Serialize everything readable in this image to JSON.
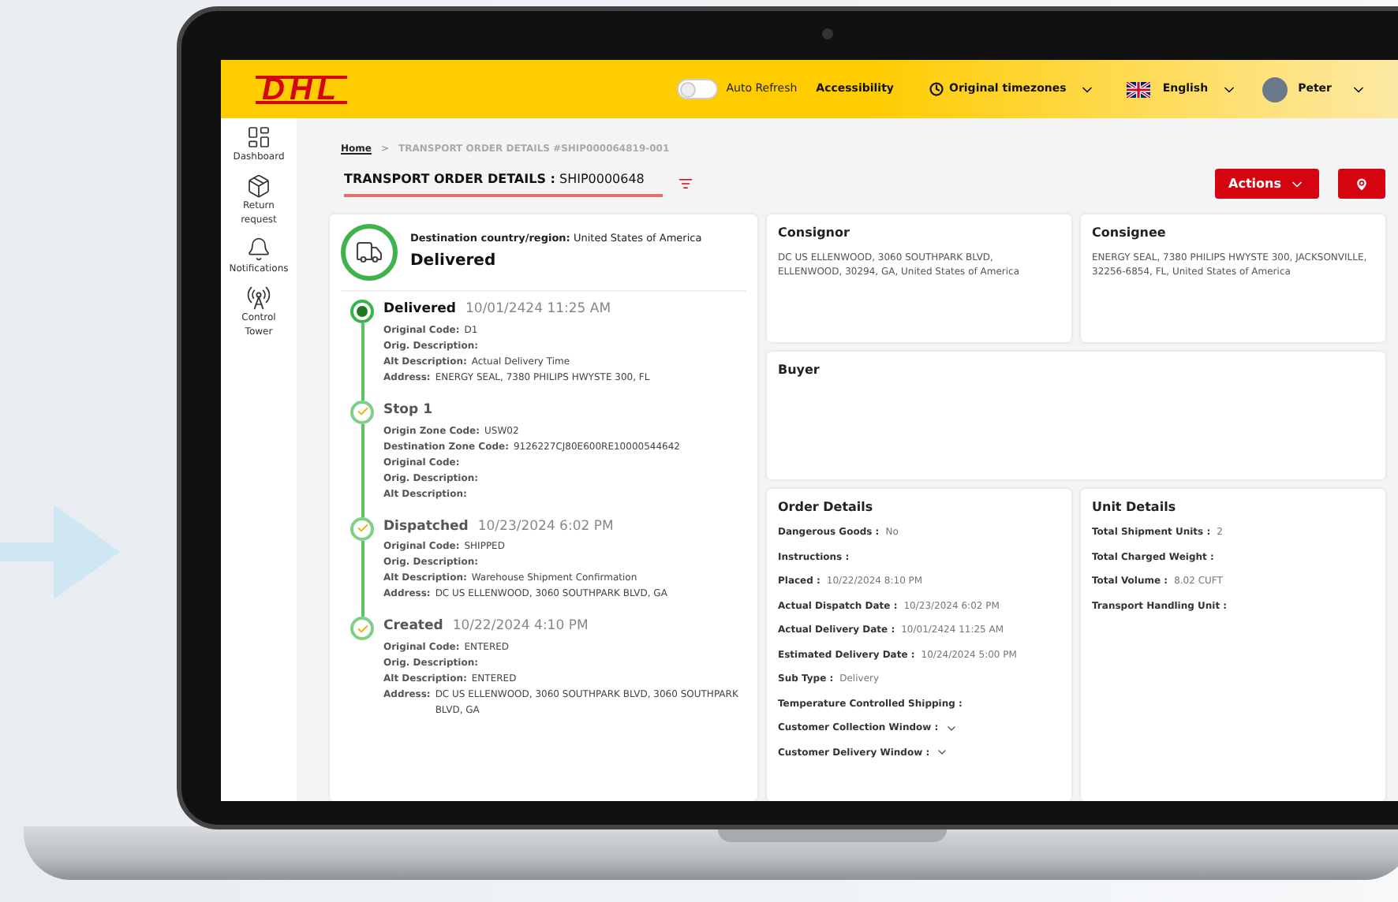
{
  "header": {
    "logo": "DHL",
    "auto_refresh": {
      "label": "Auto Refresh",
      "on": false
    },
    "accessibility": "Accessibility",
    "timezone": "Original timezones",
    "language": "English",
    "user": "Peter"
  },
  "sidebar": {
    "items": [
      {
        "label": "Dashboard",
        "kind": "dashboard"
      },
      {
        "label": "Return request",
        "kind": "return"
      },
      {
        "label": "Notifications",
        "kind": "bell"
      },
      {
        "label": "Control Tower",
        "kind": "tower"
      }
    ]
  },
  "breadcrumb": {
    "home": "Home",
    "separator": ">",
    "current": "TRANSPORT ORDER DETAILS #SHIP000064819-001"
  },
  "title": {
    "label": "TRANSPORT ORDER DETAILS :",
    "value": "SHIP0000648"
  },
  "actions": {
    "label": "Actions"
  },
  "status_card": {
    "destination_label": "Destination country/region:",
    "destination": "United States of America",
    "status": "Delivered",
    "events": [
      {
        "title": "Delivered",
        "time": "10/01/2424 11:25 AM",
        "kind": "current",
        "fields": [
          {
            "label": "Original Code:",
            "value": "D1"
          },
          {
            "label": "Orig. Description:"
          },
          {
            "label": "Alt Description:",
            "value": "Actual Delivery Time"
          },
          {
            "label": "Address:",
            "value": "ENERGY SEAL, 7380 PHILIPS HWYSTE 300, FL"
          }
        ]
      },
      {
        "title": "Stop 1",
        "kind": "done",
        "fields": [
          {
            "label": "Origin Zone Code:",
            "value": "USW02"
          },
          {
            "label": "Destination Zone Code:",
            "value": "9126227CJ80E600RE10000544642"
          },
          {
            "label": "Original Code:"
          },
          {
            "label": "Orig. Description:"
          },
          {
            "label": "Alt Description:"
          }
        ]
      },
      {
        "title": "Dispatched",
        "time": "10/23/2024 6:02 PM",
        "kind": "done",
        "fields": [
          {
            "label": "Original Code:",
            "value": "SHIPPED"
          },
          {
            "label": "Orig. Description:"
          },
          {
            "label": "Alt Description:",
            "value": "Warehouse Shipment Confirmation"
          },
          {
            "label": "Address:",
            "value": "DC US ELLENWOOD, 3060 SOUTHPARK BLVD, GA"
          }
        ]
      },
      {
        "title": "Created",
        "time": "10/22/2024 4:10 PM",
        "kind": "done",
        "fields": [
          {
            "label": "Original Code:",
            "value": "ENTERED"
          },
          {
            "label": "Orig. Description:"
          },
          {
            "label": "Alt Description:",
            "value": "ENTERED"
          },
          {
            "label": "Address:",
            "value": "DC US ELLENWOOD, 3060 SOUTHPARK BLVD, 3060 SOUTHPARK BLVD, GA"
          }
        ]
      }
    ]
  },
  "consignor": {
    "title": "Consignor",
    "text": "DC US ELLENWOOD, 3060 SOUTHPARK BLVD, ELLENWOOD, 30294, GA, United States of America"
  },
  "consignee": {
    "title": "Consignee",
    "text": "ENERGY SEAL, 7380 PHILIPS HWYSTE 300, JACKSONVILLE, 32256-6854, FL, United States of America"
  },
  "buyer": {
    "title": "Buyer"
  },
  "order_details": {
    "title": "Order Details",
    "rows": [
      {
        "label": "Dangerous Goods :",
        "value": "No",
        "kind": "text"
      },
      {
        "label": "Instructions :",
        "kind": "text"
      },
      {
        "label": "Placed :",
        "value": "10/22/2024 8:10 PM",
        "kind": "text"
      },
      {
        "label": "Actual Dispatch Date :",
        "value": "10/23/2024 6:02 PM",
        "kind": "text"
      },
      {
        "label": "Actual Delivery Date :",
        "value": "10/01/2424 11:25 AM",
        "kind": "text"
      },
      {
        "label": "Estimated Delivery Date :",
        "value": "10/24/2024 5:00 PM",
        "kind": "text"
      },
      {
        "label": "Sub Type :",
        "value": "Delivery",
        "kind": "text"
      },
      {
        "label": "Temperature Controlled Shipping :",
        "kind": "text"
      },
      {
        "label": "Customer Collection Window :",
        "kind": "dropdown"
      },
      {
        "label": "Customer Delivery Window :",
        "kind": "dropdown"
      }
    ]
  },
  "unit_details": {
    "title": "Unit Details",
    "rows": [
      {
        "label": "Total Shipment Units :",
        "value": "2"
      },
      {
        "label": "Total Charged Weight :"
      },
      {
        "label": "Total Volume :",
        "value": "8.02 CUFT"
      },
      {
        "label": "Transport Handling Unit :"
      }
    ]
  }
}
